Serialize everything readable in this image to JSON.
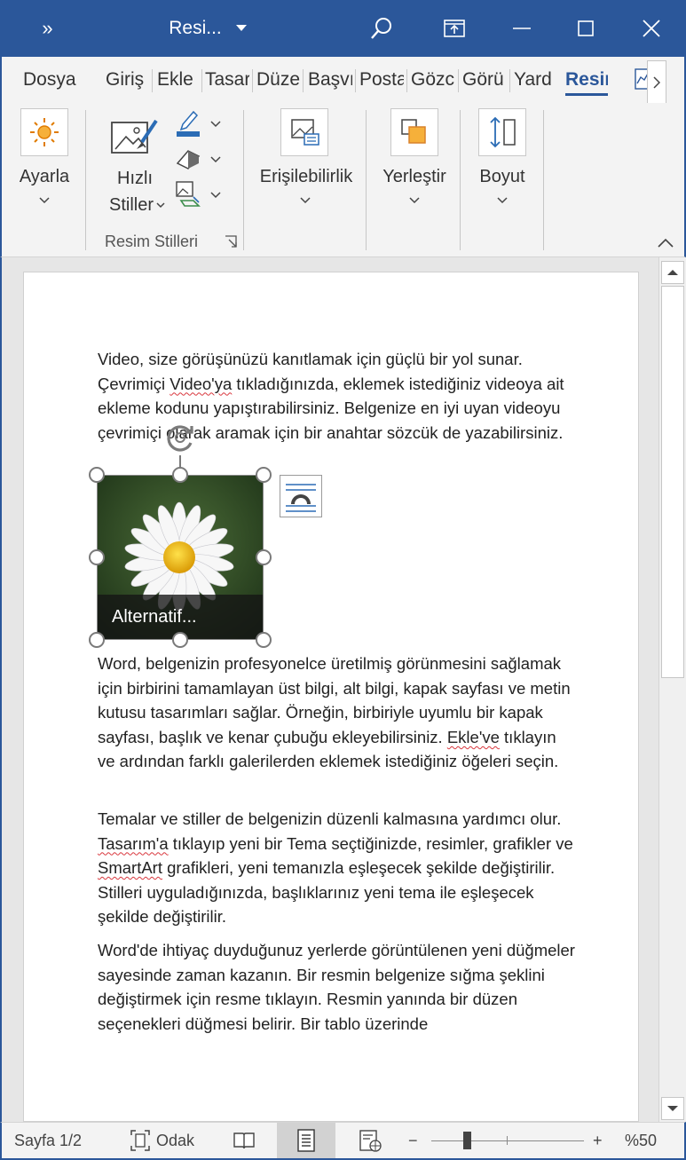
{
  "titlebar": {
    "quick_access_more": "»",
    "doc_title": "Resi...",
    "accent_color": "#2b579a"
  },
  "tabs": [
    {
      "label": "Dosya",
      "active": false
    },
    {
      "label": "Giriş",
      "active": false
    },
    {
      "label": "Ekle",
      "active": false
    },
    {
      "label": "Tasarı",
      "active": false
    },
    {
      "label": "Düze",
      "active": false
    },
    {
      "label": "Başvı",
      "active": false
    },
    {
      "label": "Posta",
      "active": false
    },
    {
      "label": "Gözc",
      "active": false
    },
    {
      "label": "Görü",
      "active": false
    },
    {
      "label": "Yard",
      "active": false
    },
    {
      "label": "Resim",
      "active": true
    }
  ],
  "ribbon": {
    "adjust_label": "Ayarla",
    "quick_styles_line1": "Hızlı",
    "quick_styles_line2": "Stiller",
    "group_label": "Resim Stilleri",
    "accessibility_label": "Erişilebilirlik",
    "arrange_label": "Yerleştir",
    "size_label": "Boyut"
  },
  "document": {
    "p1_a": "Video, size görüşünüzü kanıtlamak için güçlü bir yol sunar. Çevrimiçi ",
    "p1_err": "Video'ya",
    "p1_b": " tıkladığınızda, eklemek istediğiniz videoya ait ekleme kodunu yapıştırabilirsiniz. Belgenize en iyi uyan videoyu çevrimiçi olarak aramak için bir anahtar sözcük de yazabilirsiniz.",
    "image_alt_text": "Alternatif...",
    "p2_a": "Word, belgenizin profesyonelce üretilmiş görünmesini sağlamak için birbirini tamamlayan üst bilgi, alt bilgi, kapak sayfası ve metin kutusu tasarımları sağlar. Örneğin, birbiriyle uyumlu bir kapak sayfası, başlık ve kenar çubuğu ekleyebilirsiniz. ",
    "p2_err": "Ekle've",
    "p2_b": " tıklayın ve ardından farklı galerilerden eklemek istediğiniz öğeleri seçin.",
    "p3_a": "Temalar ve stiller de belgenizin düzenli kalmasına yardımcı olur. ",
    "p3_err1": "Tasarım'a",
    "p3_b": " tıklayıp yeni bir Tema seçtiğinizde, resimler, grafikler ve ",
    "p3_err2": "SmartArt",
    "p3_c": " grafikleri, yeni temanızla eşleşecek şekilde değiştirilir. Stilleri uyguladığınızda, başlıklarınız yeni tema ile eşleşecek şekilde değiştirilir.",
    "p4": "Word'de ihtiyaç duyduğunuz yerlerde görüntülenen yeni düğmeler sayesinde zaman kazanın. Bir resmin belgenize sığma şeklini değiştirmek için resme tıklayın. Resmin yanında bir düzen seçenekleri düğmesi belirir. Bir tablo üzerinde"
  },
  "statusbar": {
    "page": "Sayfa 1/2",
    "focus": "Odak",
    "zoom_minus": "−",
    "zoom_plus": "+",
    "zoom": "%50",
    "zoom_value_percent": 50
  }
}
